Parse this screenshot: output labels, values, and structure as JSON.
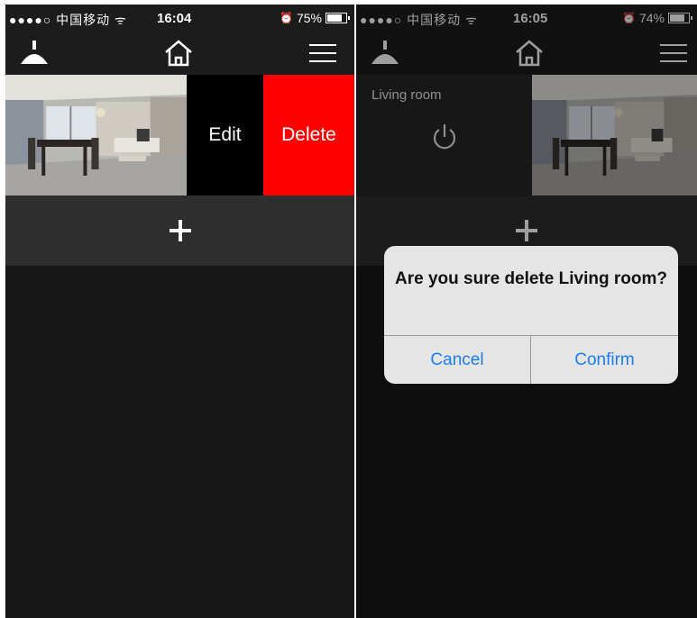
{
  "left": {
    "status": {
      "signal": "●●●●○ 中国移动 ᯤ",
      "time": "16:04",
      "battery": "75%",
      "battery_level": 0.75
    },
    "room_row": {
      "edit_label": "Edit",
      "delete_label": "Delete"
    },
    "add_label": "+"
  },
  "right": {
    "status": {
      "signal": "●●●●○ 中国移动 ᯤ",
      "time": "16:05",
      "battery": "74%",
      "battery_level": 0.74
    },
    "room_row": {
      "room_name": "Living room"
    },
    "add_label": "+",
    "dialog": {
      "message": "Are you sure delete Living room?",
      "cancel_label": "Cancel",
      "confirm_label": "Confirm"
    }
  },
  "colors": {
    "delete": "#fe0000",
    "edit": "#000000",
    "dialog_button": "#1c7cf4",
    "background": "#171717"
  }
}
